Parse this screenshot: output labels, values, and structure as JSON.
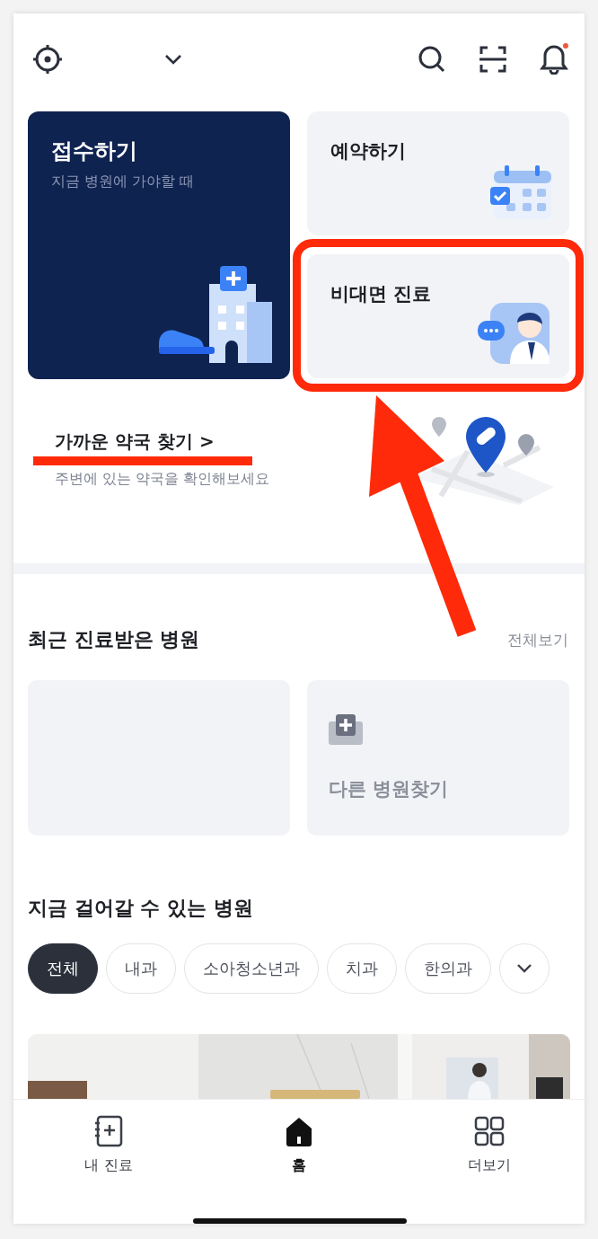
{
  "header": {
    "notification": true
  },
  "services": [
    {
      "kind": "primary",
      "title": "접수하기",
      "subtitle": "지금 병원에 가야할 때"
    },
    {
      "kind": "calendar",
      "title": "예약하기"
    },
    {
      "kind": "remote",
      "title": "비대면 진료",
      "highlighted": true
    }
  ],
  "pharmacy": {
    "title": "가까운 약국 찾기",
    "arrow": ">",
    "subtitle": "주변에 있는 약국을 확인해보세요"
  },
  "recent": {
    "title": "최근 진료받은 병원",
    "see_all": "전체보기",
    "find_other": "다른 병원찾기"
  },
  "nearby": {
    "title": "지금 걸어갈 수 있는 병원",
    "chips": [
      {
        "label": "전체",
        "selected": true
      },
      {
        "label": "내과",
        "selected": false
      },
      {
        "label": "소아청소년과",
        "selected": false
      },
      {
        "label": "치과",
        "selected": false
      },
      {
        "label": "한의과",
        "selected": false
      }
    ]
  },
  "nav": [
    {
      "kind": "records",
      "label": "내 진료",
      "selected": false
    },
    {
      "kind": "home",
      "label": "홈",
      "selected": true
    },
    {
      "kind": "more",
      "label": "더보기",
      "selected": false
    }
  ]
}
